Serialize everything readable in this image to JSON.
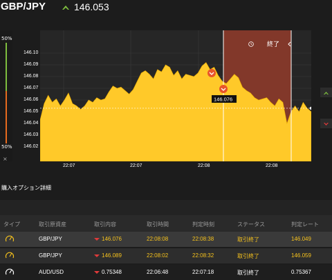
{
  "header": {
    "pair": "GBP/JPY",
    "price": "146.053",
    "trend": "up",
    "up_color": "#7fbf3f"
  },
  "chart": {
    "left_panel": {
      "pct_top": "50%",
      "pct_bottom": "50%",
      "close": "×"
    },
    "end_label": "終了",
    "marker_price": "146.076",
    "y_ticks": [
      "146.10",
      "146.09",
      "146.08",
      "146.07",
      "146.06",
      "146.05",
      "146.04",
      "146.03",
      "146.02"
    ],
    "x_ticks": [
      "22:07",
      "22:07",
      "22:08",
      "22:08"
    ]
  },
  "chart_data": {
    "type": "area",
    "title": "",
    "xlabel": "",
    "ylabel": "",
    "x_ticks": [
      "22:07",
      "22:07",
      "22:08",
      "22:08"
    ],
    "ylim": [
      146.01,
      146.11
    ],
    "y_ticks": [
      146.02,
      146.03,
      146.04,
      146.05,
      146.06,
      146.07,
      146.08,
      146.09,
      146.1
    ],
    "series": [
      {
        "values": [
          146.043,
          146.057,
          146.064,
          146.058,
          146.061,
          146.055,
          146.06,
          146.066,
          146.057,
          146.055,
          146.052,
          146.055,
          146.06,
          146.058,
          146.062,
          146.06,
          146.061,
          146.067,
          146.072,
          146.07,
          146.071,
          146.068,
          146.065,
          146.069,
          146.076,
          146.083,
          146.085,
          146.082,
          146.078,
          146.086,
          146.084,
          146.09,
          146.088,
          146.081,
          146.085,
          146.078,
          146.082,
          146.081,
          146.08,
          146.083,
          146.089,
          146.092,
          146.086,
          146.088,
          146.081,
          146.076,
          146.074,
          146.078,
          146.082,
          146.079,
          146.071,
          146.068,
          146.066,
          146.062,
          146.06,
          146.061,
          146.062,
          146.058,
          146.055,
          146.061,
          146.058,
          146.04,
          146.05,
          146.055,
          146.05,
          146.058,
          146.053,
          146.05
        ]
      }
    ],
    "current_price": 146.053,
    "entry_marker": 146.076,
    "grid": true
  },
  "details": {
    "title": "購入オプション詳細",
    "columns": [
      "タイプ",
      "取引原資産",
      "取引内容",
      "取引時間",
      "判定時刻",
      "ステータス",
      "判定レート"
    ],
    "rows": [
      {
        "asset": "GBP/JPY",
        "content": "146.076",
        "time": "22:08:08",
        "judge": "22:08:38",
        "status": "取引終了",
        "rate": "146.049"
      },
      {
        "asset": "GBP/JPY",
        "content": "146.089",
        "time": "22:08:02",
        "judge": "22:08:32",
        "status": "取引終了",
        "rate": "146.059"
      },
      {
        "asset": "AUD/USD",
        "content": "0.75348",
        "time": "22:06:48",
        "judge": "22:07:18",
        "status": "取引終了",
        "rate": "0.75367"
      }
    ]
  },
  "colors": {
    "area": "#ffc929",
    "end_zone": "#8a3a2a",
    "marker": "#e8552a",
    "status": "#f6c21d",
    "down": "#e03a3a"
  },
  "icons": {
    "gauge": "gauge-icon",
    "down_arrow": "down-triangle-icon",
    "clock": "clock-icon"
  }
}
